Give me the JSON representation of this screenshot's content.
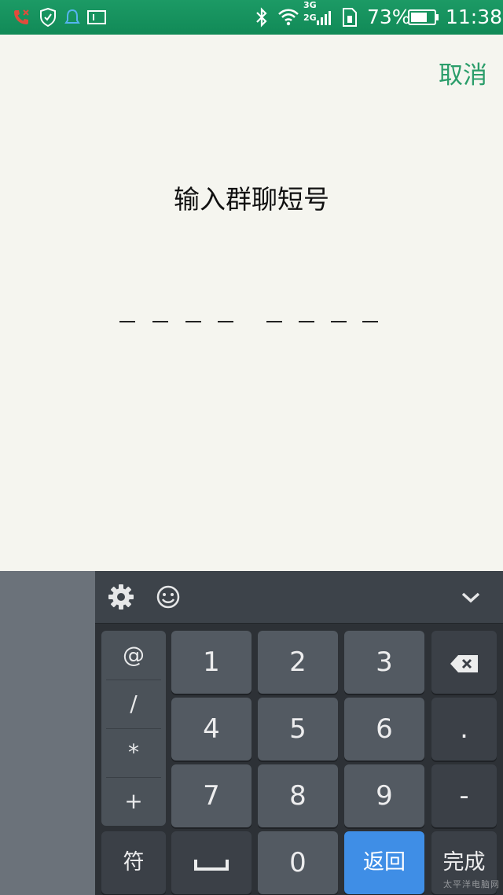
{
  "status_bar": {
    "icons": [
      "missed-call-icon",
      "shield-icon",
      "bell-icon",
      "input-method-icon",
      "bluetooth-icon",
      "wifi-icon",
      "signal-icon",
      "sim-icon",
      "battery-icon"
    ],
    "network_top": "3G",
    "network_bottom": "2G",
    "battery_percent": "73%",
    "battery_level": 0.73,
    "time": "11:38"
  },
  "header": {
    "cancel_label": "取消"
  },
  "main": {
    "title": "输入群聊短号",
    "code_slots": 8,
    "code_value": ""
  },
  "keyboard": {
    "toolbar": {
      "icons": [
        "gear-icon",
        "emoji-icon",
        "chevron-down-icon"
      ]
    },
    "symbols": [
      "@",
      "/",
      "*",
      "+"
    ],
    "digits": [
      "1",
      "2",
      "3",
      "4",
      "5",
      "6",
      "7",
      "8",
      "9"
    ],
    "right_keys": {
      "dot": ".",
      "minus": "-"
    },
    "bottom_row": {
      "symbols_label": "符",
      "zero": "0",
      "return_label": "返回",
      "done_label": "完成"
    },
    "watermark": "太平洋电脑网"
  },
  "colors": {
    "status_bar": "#1c9a65",
    "accent": "#2a9d6a",
    "background": "#f5f5ef",
    "keyboard": "#2d3136",
    "key": "#535a62",
    "return_key": "#3f8ee6"
  }
}
